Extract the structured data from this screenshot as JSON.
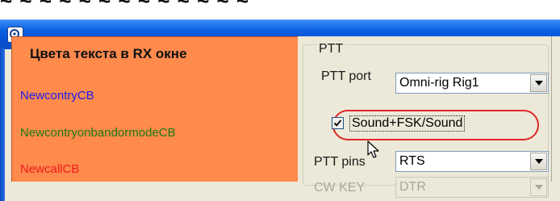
{
  "colors": {
    "panel_bg": "#fe8a4c",
    "titlebar": "#0552d6",
    "highlight": "#e02828",
    "newcountry": "#1a1aee",
    "newcountry_band": "#1e7a12",
    "newcall": "#ee1a1a"
  },
  "left_panel": {
    "title": "Цвета текста в RX окне",
    "items": [
      {
        "label": "NewcontryCB",
        "color": "#1a1aee"
      },
      {
        "label": "NewcontryonbandormodeCB",
        "color": "#1e7a12"
      },
      {
        "label": "NewcallCB",
        "color": "#ee1a1a"
      }
    ]
  },
  "ptt": {
    "group_title": "PTT",
    "port_label": "PTT port",
    "port_value": "Omni-rig Rig1",
    "checkbox_label": "Sound+FSK/Sound",
    "checkbox_checked": true,
    "pins_label": "PTT pins",
    "pins_value": "RTS",
    "cwkey_label": "CW KEY",
    "cwkey_value": "DTR"
  }
}
